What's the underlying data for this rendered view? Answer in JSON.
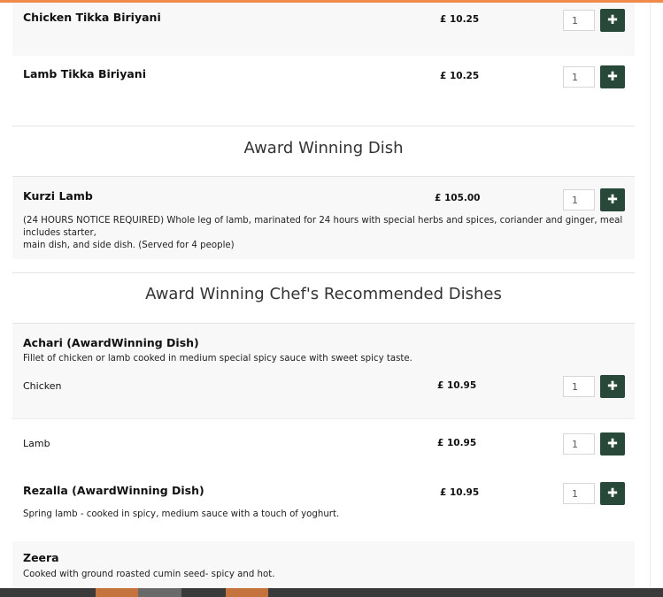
{
  "colors": {
    "accent_top": "#f08a4b",
    "add_button": "#28493a",
    "row_shade": "#f8f8f8",
    "bottom_bar": "#3a3a3a",
    "bottom_orange": "#c5733d",
    "bottom_grey": "#6a6a6a"
  },
  "add_icon": "plus-icon",
  "sections": {
    "award_dish": "Award Winning Dish",
    "chef_recommended": "Award Winning Chef's Recommended Dishes"
  },
  "items": {
    "chicken_tikka_biriyani": {
      "name": "Chicken Tikka Biriyani",
      "price": "£ 10.25",
      "qty": "1"
    },
    "lamb_tikka_biriyani": {
      "name": "Lamb Tikka Biriyani",
      "price": "£ 10.25",
      "qty": "1"
    },
    "kurzi_lamb": {
      "name": "Kurzi Lamb",
      "price": "£ 105.00",
      "qty": "1",
      "desc_line1": "(24 HOURS NOTICE REQUIRED) Whole leg of lamb, marinated for 24 hours with special herbs and spices, coriander and ginger, meal includes starter,",
      "desc_line2": "main dish, and side dish. (Served for 4 people)"
    },
    "achari": {
      "name": "Achari (AwardWinning Dish)",
      "desc": "Fillet of chicken or lamb cooked in medium special spicy sauce with sweet spicy taste.",
      "variants": [
        {
          "name": "Chicken",
          "price": "£ 10.95",
          "qty": "1"
        },
        {
          "name": "Lamb",
          "price": "£ 10.95",
          "qty": "1"
        }
      ]
    },
    "rezalla": {
      "name": "Rezalla (AwardWinning Dish)",
      "price": "£ 10.95",
      "qty": "1",
      "desc": "Spring lamb - cooked in spicy, medium sauce with a touch of yoghurt."
    },
    "zeera": {
      "name": "Zeera",
      "desc": "Cooked with ground roasted cumin seed- spicy and hot."
    }
  }
}
